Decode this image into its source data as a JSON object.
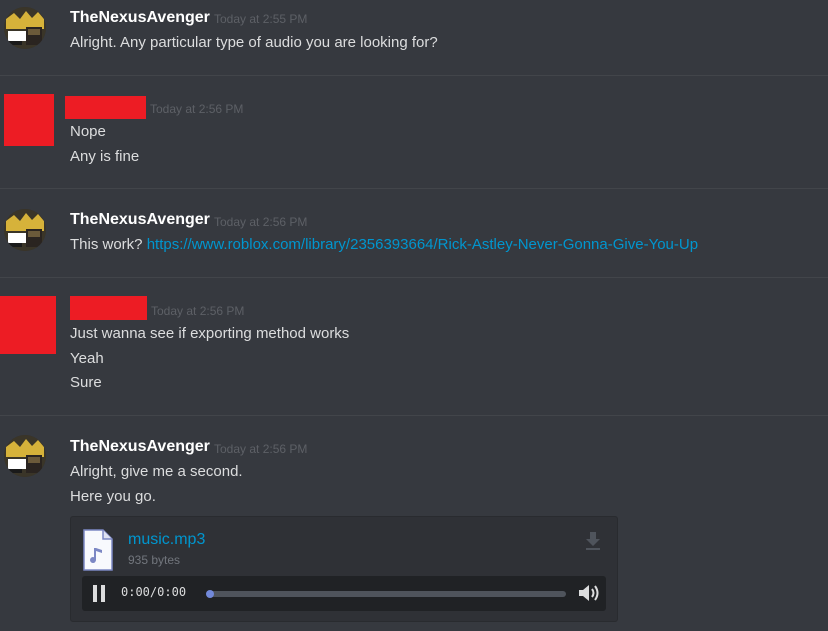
{
  "messages": [
    {
      "author": "TheNexusAvenger",
      "timestamp": "Today at 2:55 PM",
      "lines": [
        "Alright. Any particular type of audio you are looking for?"
      ]
    },
    {
      "author": "",
      "timestamp": "Today at 2:56 PM",
      "lines": [
        "Nope",
        "Any is fine"
      ]
    },
    {
      "author": "TheNexusAvenger",
      "timestamp": "Today at 2:56 PM",
      "prefix": "This work?",
      "link": "https://www.roblox.com/library/2356393664/Rick-Astley-Never-Gonna-Give-You-Up"
    },
    {
      "author": "",
      "timestamp": "Today at 2:56 PM",
      "lines": [
        "Just wanna see if exporting method works",
        "Yeah",
        "Sure"
      ]
    },
    {
      "author": "TheNexusAvenger",
      "timestamp": "Today at 2:56 PM",
      "lines": [
        "Alright, give me a second.",
        "Here you go."
      ]
    }
  ],
  "attachment": {
    "filename": "music.mp3",
    "size": "935 bytes",
    "time_current": "0:00",
    "time_separator": "/",
    "time_total": "0:00",
    "progress_fraction": 0,
    "icons": {
      "file": "audio-file-icon",
      "download": "download-icon",
      "pause": "pause-icon",
      "volume": "volume-icon"
    }
  },
  "colors": {
    "background": "#36393f",
    "username": "#ffffff",
    "timestamp": "#5d6066",
    "text": "#dcddde",
    "link": "#0096cf",
    "redaction": "#ed1c24",
    "progress_knob": "#7289da"
  }
}
